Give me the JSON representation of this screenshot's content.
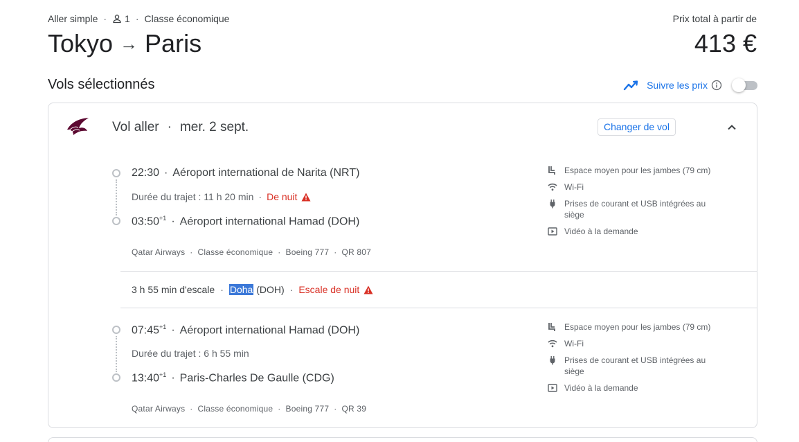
{
  "summary": {
    "trip_type": "Aller simple",
    "passengers": "1",
    "cabin": "Classe économique",
    "origin": "Tokyo",
    "destination": "Paris",
    "arrow": "→",
    "price_label": "Prix total à partir de",
    "price": "413 €"
  },
  "section": {
    "title": "Vols sélectionnés",
    "track_label": "Suivre les prix",
    "track_enabled": false
  },
  "leg": {
    "title": "Vol aller",
    "date": "mer. 2 sept.",
    "change_label": "Changer de vol",
    "segments": [
      {
        "dep_time": "22:30",
        "dep_offset": "",
        "dep_airport": "Aéroport international de Narita (NRT)",
        "duration": "Durée du trajet : 11 h 20 min",
        "overnight": "De nuit",
        "arr_time": "03:50",
        "arr_offset": "+1",
        "arr_airport": "Aéroport international Hamad (DOH)",
        "airline": "Qatar Airways",
        "cabin": "Classe économique",
        "aircraft": "Boeing 777",
        "flight": "QR 807",
        "amenities": [
          {
            "icon": "legroom-icon",
            "text": "Espace moyen pour les jambes (79 cm)"
          },
          {
            "icon": "wifi-icon",
            "text": "Wi-Fi"
          },
          {
            "icon": "power-plug-icon",
            "text": "Prises de courant et USB intégrées au siège"
          },
          {
            "icon": "video-icon",
            "text": "Vidéo à la demande"
          }
        ]
      },
      {
        "dep_time": "07:45",
        "dep_offset": "+1",
        "dep_airport": "Aéroport international Hamad (DOH)",
        "duration": "Durée du trajet : 6 h 55 min",
        "overnight": "",
        "arr_time": "13:40",
        "arr_offset": "+1",
        "arr_airport": "Paris-Charles De Gaulle (CDG)",
        "airline": "Qatar Airways",
        "cabin": "Classe économique",
        "aircraft": "Boeing 777",
        "flight": "QR 39",
        "amenities": [
          {
            "icon": "legroom-icon",
            "text": "Espace moyen pour les jambes (79 cm)"
          },
          {
            "icon": "wifi-icon",
            "text": "Wi-Fi"
          },
          {
            "icon": "power-plug-icon",
            "text": "Prises de courant et USB intégrées au siège"
          },
          {
            "icon": "video-icon",
            "text": "Vidéo à la demande"
          }
        ]
      }
    ],
    "layover": {
      "duration": "3 h 55 min d'escale",
      "city": "Doha",
      "code": "(DOH)",
      "note": "Escale de nuit"
    }
  },
  "separators": {
    "dot": "·"
  },
  "colors": {
    "accent": "#1a73e8",
    "warning": "#d93025",
    "border": "#dadce0"
  }
}
